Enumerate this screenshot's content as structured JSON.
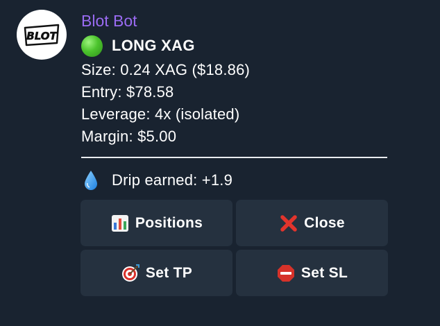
{
  "bot": {
    "name": "Blot Bot",
    "avatar_text": "BLOT",
    "avatar_icon": "blot-logo-icon"
  },
  "message": {
    "status_icon": "green-circle-icon",
    "headline": "LONG XAG",
    "lines": [
      "Size: 0.24 XAG ($18.86)",
      "Entry: $78.58",
      "Leverage: 4x (isolated)",
      "Margin: $5.00"
    ],
    "drip_icon": "droplet-icon",
    "drip_text": "Drip earned: +1.9"
  },
  "buttons": [
    {
      "label": "Positions",
      "icon": "bar-chart-icon"
    },
    {
      "label": "Close",
      "icon": "red-x-icon"
    },
    {
      "label": "Set TP",
      "icon": "target-icon"
    },
    {
      "label": "Set SL",
      "icon": "stop-sign-icon"
    }
  ],
  "colors": {
    "background": "#192330",
    "sender_name": "#9a6bf2",
    "button_bg": "#25313f",
    "text": "#ffffff"
  }
}
